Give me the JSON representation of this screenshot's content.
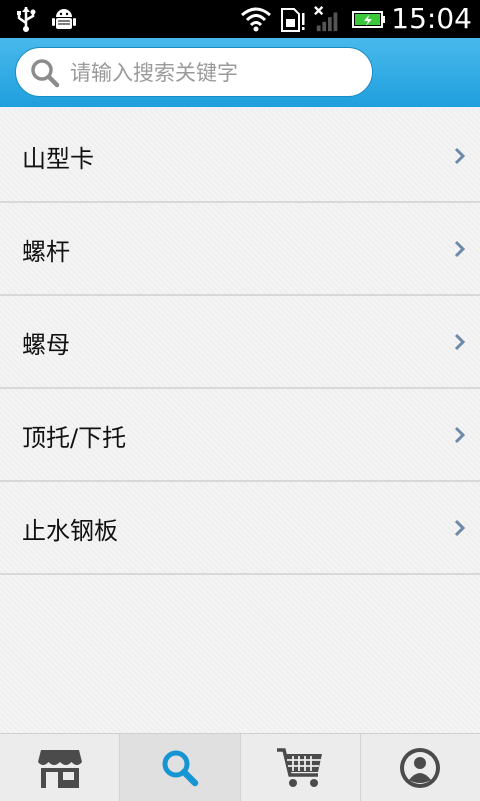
{
  "status_bar": {
    "time": "15:04",
    "icons": [
      "usb-icon",
      "android-debug-icon",
      "wifi-icon",
      "sim-card-icon",
      "no-signal-icon",
      "battery-charging-icon"
    ]
  },
  "search": {
    "placeholder": "请输入搜索关键字",
    "value": ""
  },
  "list": {
    "items": [
      {
        "label": "山型卡"
      },
      {
        "label": "螺杆"
      },
      {
        "label": "螺母"
      },
      {
        "label": "顶托/下托"
      },
      {
        "label": "止水钢板"
      }
    ]
  },
  "bottom_nav": {
    "active_index": 1,
    "tabs": [
      {
        "icon": "store-icon"
      },
      {
        "icon": "search-icon"
      },
      {
        "icon": "cart-icon"
      },
      {
        "icon": "user-profile-icon"
      }
    ]
  },
  "colors": {
    "header_blue": "#29a7e2",
    "icon_gray": "#4b4b4b",
    "active_icon_blue": "#1795d3"
  }
}
